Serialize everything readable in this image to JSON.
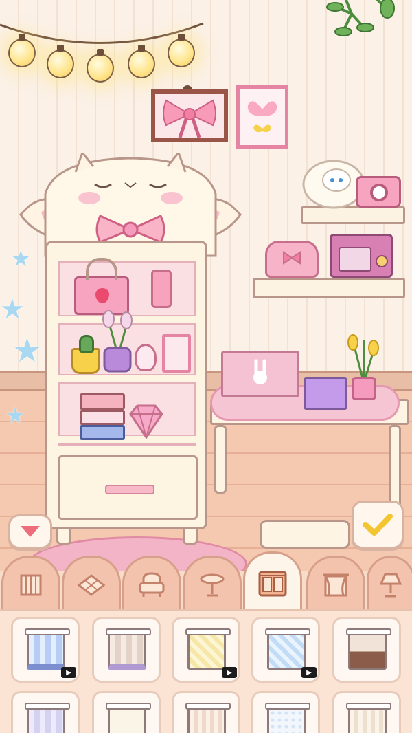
{
  "scene": {
    "string_lights": {
      "count": 5,
      "glow_color": "#ffe48a"
    },
    "wall_items": [
      "bow-painting",
      "butterfly-picture",
      "hanging-plant"
    ],
    "shelf_items": [
      "sheep-plush",
      "pink-camera",
      "pink-purse",
      "retro-radio"
    ],
    "cabinet": {
      "style": "sheep-face-cabinet",
      "items": [
        "pink-handbag",
        "perfume-bottle",
        "tulip-pot",
        "cactus-pot",
        "potion-bottle",
        "photo-frame",
        "book-stack",
        "pink-diamond"
      ]
    },
    "desk_items": [
      "bunny-laptop",
      "purple-book",
      "yellow-tulip-pot"
    ]
  },
  "controls": {
    "collapse_icon": "triangle-down-icon",
    "confirm_icon": "checkmark-icon"
  },
  "category_tabs": [
    {
      "id": "wallpaper",
      "icon": "wallpaper-icon",
      "active": false
    },
    {
      "id": "floor",
      "icon": "floor-tile-icon",
      "active": false
    },
    {
      "id": "seat",
      "icon": "armchair-icon",
      "active": false
    },
    {
      "id": "table",
      "icon": "round-table-icon",
      "active": false
    },
    {
      "id": "cabinet",
      "icon": "cabinet-icon",
      "active": true
    },
    {
      "id": "window",
      "icon": "curtain-window-icon",
      "active": false
    },
    {
      "id": "lamp",
      "icon": "lamp-icon",
      "active": false
    }
  ],
  "items": [
    {
      "id": "item-1",
      "pattern": "blue-stripes",
      "video_ad": true
    },
    {
      "id": "item-2",
      "pattern": "beige-stripes",
      "video_ad": false
    },
    {
      "id": "item-3",
      "pattern": "yellow-diamond",
      "video_ad": true
    },
    {
      "id": "item-4",
      "pattern": "blue-diamond",
      "video_ad": true
    },
    {
      "id": "item-5",
      "pattern": "brown-wainscot",
      "video_ad": false
    },
    {
      "id": "item-6",
      "pattern": "lavender-stripes",
      "video_ad": false
    },
    {
      "id": "item-7",
      "pattern": "cream-plain",
      "video_ad": false
    },
    {
      "id": "item-8",
      "pattern": "cream-stripes",
      "video_ad": false
    },
    {
      "id": "item-9",
      "pattern": "blue-dots",
      "video_ad": false
    },
    {
      "id": "item-10",
      "pattern": "cream-stripes-2",
      "video_ad": false
    }
  ],
  "colors": {
    "accent_pink": "#f59bbd",
    "tab_bg": "#f3c3ae",
    "tab_active_bg": "#fdf4ea",
    "confirm_check": "#f2c531"
  }
}
